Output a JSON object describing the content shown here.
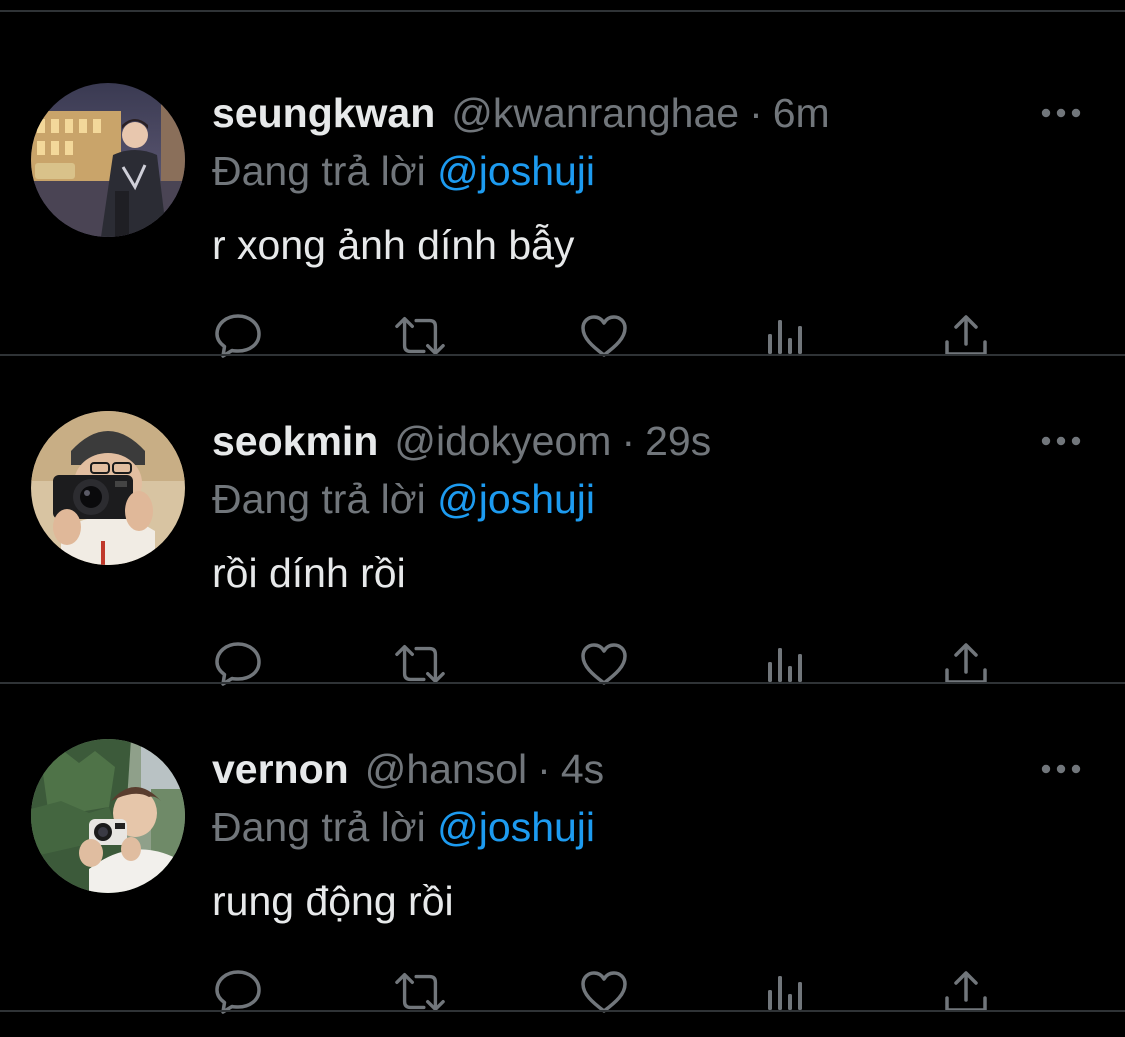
{
  "colors": {
    "background": "#000000",
    "divider": "#2f3336",
    "primary_text": "#e7e9ea",
    "secondary_text": "#71767b",
    "link": "#1d9bf0"
  },
  "icons": {
    "more": "more-horizontal-icon",
    "reply": "speech-bubble-icon",
    "retweet": "retweet-icon",
    "like": "heart-icon",
    "views": "bar-chart-icon",
    "share": "share-upload-icon"
  },
  "replying_prefix": "Đang trả lời",
  "tweets": [
    {
      "display_name": "seungkwan",
      "handle": "@kwanranghae",
      "separator": "·",
      "time": "6m",
      "reply_to": "@joshuji",
      "text": "r xong ảnh dính bẫy"
    },
    {
      "display_name": "seokmin",
      "handle": "@idokyeom",
      "separator": "·",
      "time": "29s",
      "reply_to": "@joshuji",
      "text": "rồi dính rồi"
    },
    {
      "display_name": "vernon",
      "handle": "@hansol",
      "separator": "·",
      "time": "4s",
      "reply_to": "@joshuji",
      "text": "rung động rồi"
    }
  ]
}
